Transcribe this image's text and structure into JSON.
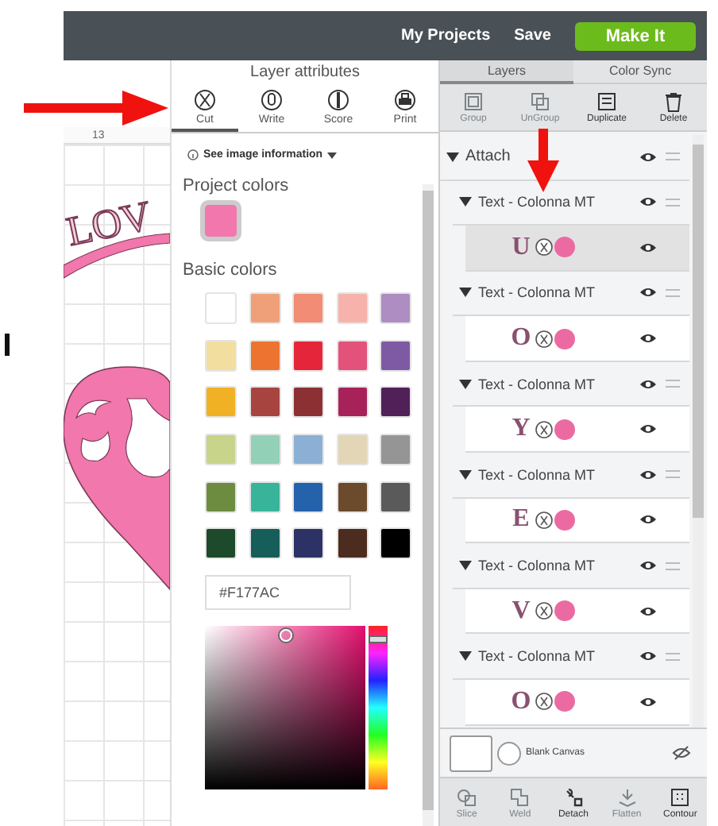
{
  "top_bar": {
    "links": [
      "My Projects",
      "Save"
    ],
    "make_it_button": "Make It"
  },
  "canvas": {
    "ruler_label": "13",
    "design_text": "LOV"
  },
  "layer_attributes": {
    "title": "Layer attributes",
    "tabs": [
      {
        "label": "Cut",
        "kind": "cut",
        "selected": true
      },
      {
        "label": "Write",
        "kind": "write",
        "selected": false
      },
      {
        "label": "Score",
        "kind": "score",
        "selected": false
      },
      {
        "label": "Print",
        "kind": "print",
        "selected": false
      }
    ],
    "info_link": "See image information",
    "project_colors": {
      "title": "Project colors",
      "swatches": [
        {
          "color": "#f177ac",
          "selected": true
        }
      ]
    },
    "basic_colors": {
      "title": "Basic colors",
      "swatches": [
        {
          "color": "#ffffff"
        },
        {
          "color": "#f0a078"
        },
        {
          "color": "#f28c74"
        },
        {
          "color": "#f7b3ab"
        },
        {
          "color": "#ad8dc2"
        },
        {
          "color": "#f2dfa0"
        },
        {
          "color": "#ec7430"
        },
        {
          "color": "#e5263a"
        },
        {
          "color": "#e2527a"
        },
        {
          "color": "#7f5aa4"
        },
        {
          "color": "#f0b124"
        },
        {
          "color": "#a84440"
        },
        {
          "color": "#8c3034"
        },
        {
          "color": "#a8225a"
        },
        {
          "color": "#512059"
        },
        {
          "color": "#c8d48a"
        },
        {
          "color": "#93d0b8"
        },
        {
          "color": "#8bb0d4"
        },
        {
          "color": "#e2d6b6"
        },
        {
          "color": "#959595"
        },
        {
          "color": "#6d8c40"
        },
        {
          "color": "#38b49a"
        },
        {
          "color": "#2562ac"
        },
        {
          "color": "#6c4a2c"
        },
        {
          "color": "#5a5a5a"
        },
        {
          "color": "#1c4a2a"
        },
        {
          "color": "#155e5a"
        },
        {
          "color": "#2c3266"
        },
        {
          "color": "#4c2c1e"
        },
        {
          "color": "#000000"
        }
      ]
    },
    "hex_field": {
      "value": "#F177AC"
    },
    "hue_slider": {
      "level": 0.06
    }
  },
  "layers_panel": {
    "tabs": [
      {
        "label": "Layers",
        "selected": true
      },
      {
        "label": "Color Sync",
        "selected": false
      }
    ],
    "toolbar": [
      {
        "label": "Group",
        "kind": "group",
        "disabled": true
      },
      {
        "label": "UnGroup",
        "kind": "ungroup",
        "disabled": true
      },
      {
        "label": "Duplicate",
        "kind": "duplicate",
        "disabled": false
      },
      {
        "label": "Delete",
        "kind": "delete",
        "disabled": false
      }
    ],
    "tree": [
      {
        "kind": "group",
        "label": "Attach",
        "expanded": true,
        "children": [
          {
            "kind": "group",
            "label": "Text - Colonna MT",
            "expanded": true,
            "children": [
              {
                "kind": "layer",
                "glyph": "U",
                "selected": true
              }
            ]
          },
          {
            "kind": "group",
            "label": "Text - Colonna MT",
            "expanded": true,
            "children": [
              {
                "kind": "layer",
                "glyph": "O",
                "selected": false
              }
            ]
          },
          {
            "kind": "group",
            "label": "Text - Colonna MT",
            "expanded": true,
            "children": [
              {
                "kind": "layer",
                "glyph": "Y",
                "selected": false
              }
            ]
          },
          {
            "kind": "group",
            "label": "Text - Colonna MT",
            "expanded": true,
            "children": [
              {
                "kind": "layer",
                "glyph": "E",
                "selected": false
              }
            ]
          },
          {
            "kind": "group",
            "label": "Text - Colonna MT",
            "expanded": true,
            "children": [
              {
                "kind": "layer",
                "glyph": "V",
                "selected": false
              }
            ]
          },
          {
            "kind": "group",
            "label": "Text - Colonna MT",
            "expanded": true,
            "children": [
              {
                "kind": "layer",
                "glyph": "O",
                "selected": false
              }
            ]
          }
        ]
      }
    ],
    "blank_canvas": {
      "label": "Blank Canvas"
    },
    "bottom_toolbar": [
      {
        "label": "Slice",
        "kind": "slice",
        "disabled": true
      },
      {
        "label": "Weld",
        "kind": "weld",
        "disabled": true
      },
      {
        "label": "Detach",
        "kind": "detach",
        "disabled": false
      },
      {
        "label": "Flatten",
        "kind": "flatten",
        "disabled": true
      },
      {
        "label": "Contour",
        "kind": "contour",
        "disabled": false
      }
    ]
  }
}
